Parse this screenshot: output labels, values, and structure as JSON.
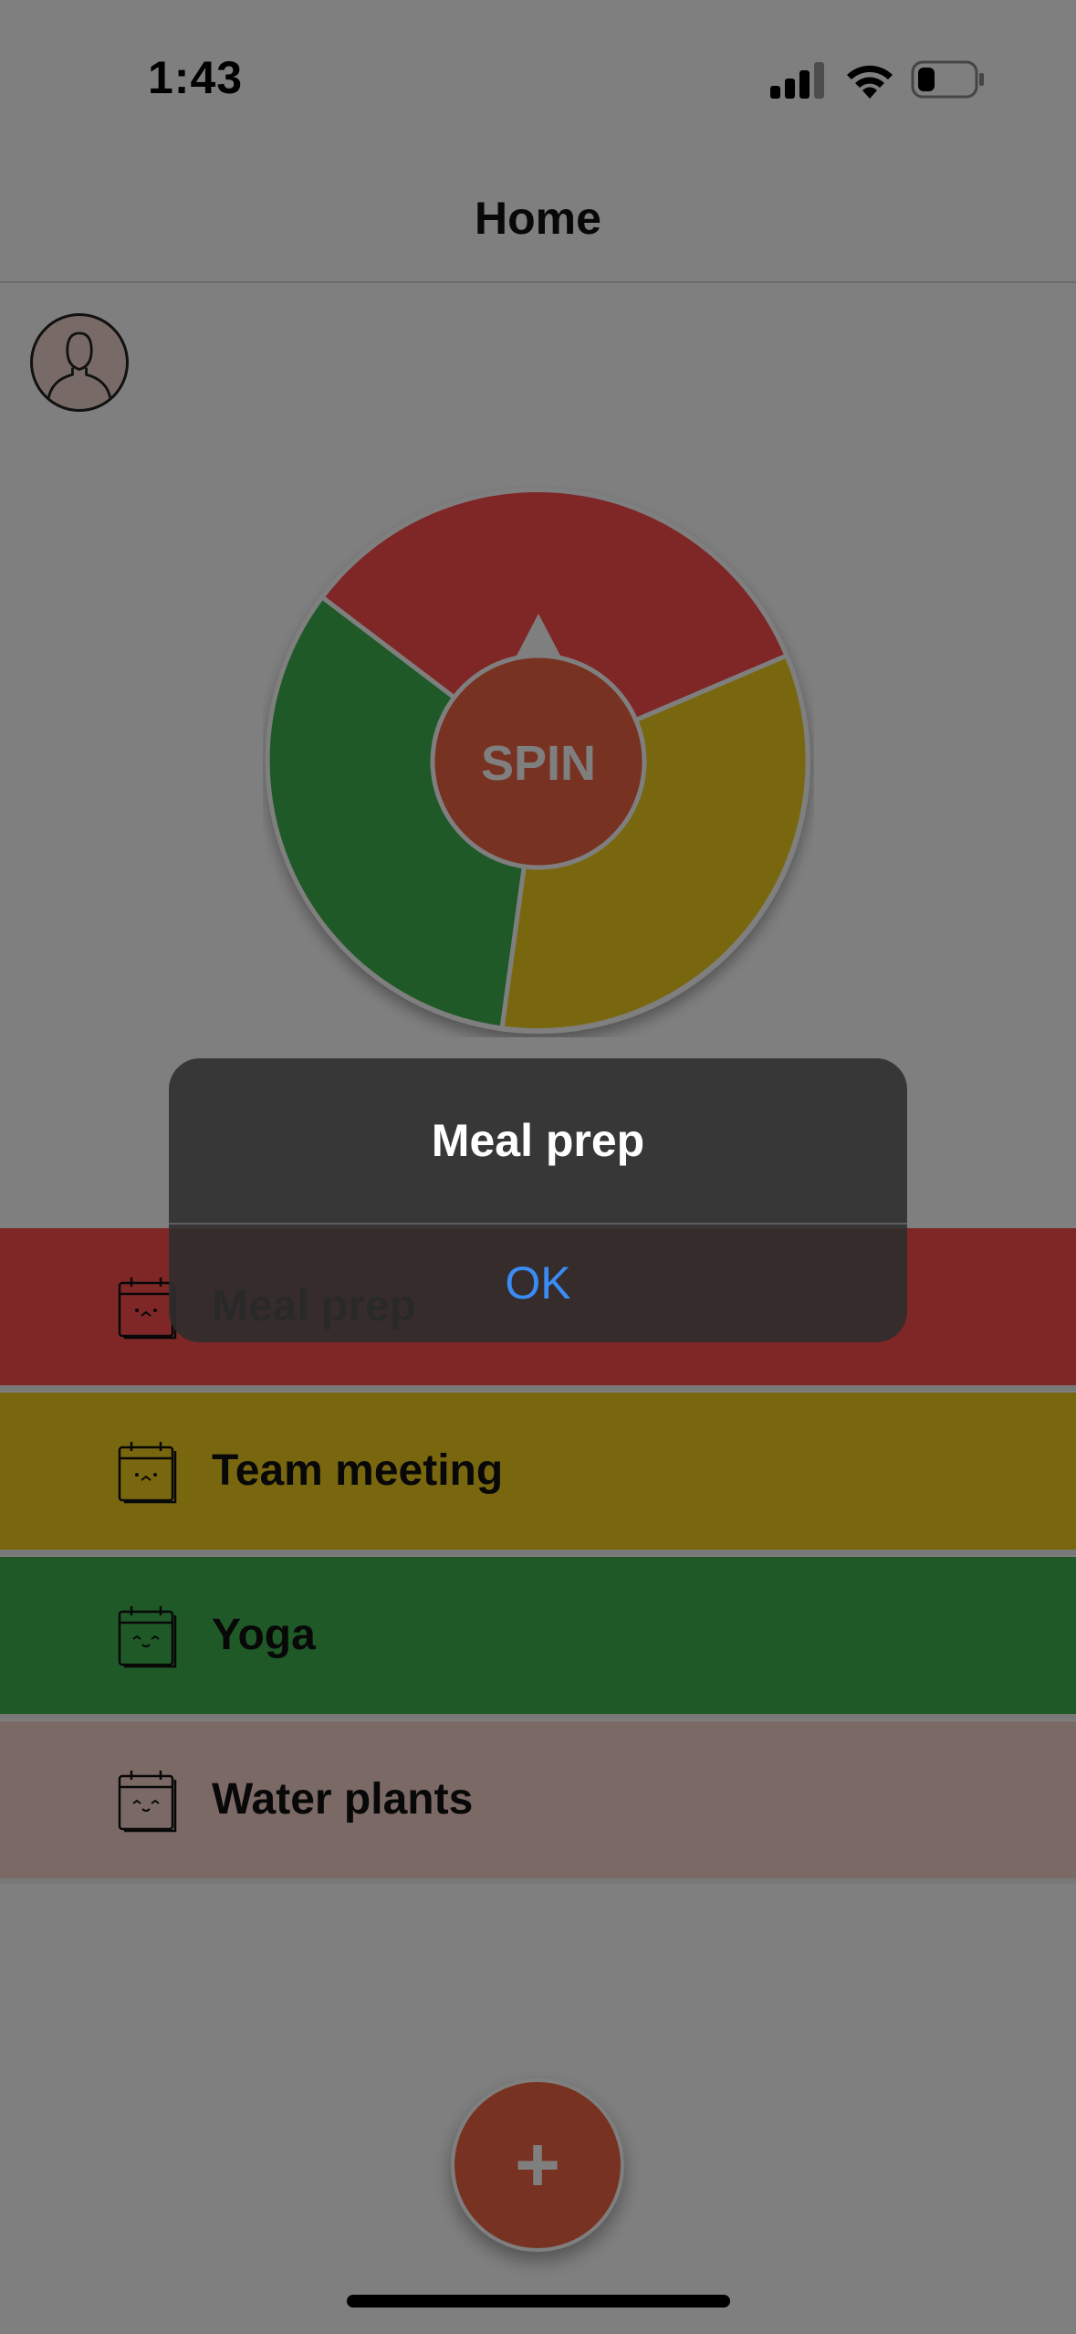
{
  "status_bar": {
    "time": "1:43",
    "icons": [
      "signal-icon",
      "wifi-icon",
      "battery-icon"
    ]
  },
  "nav": {
    "title": "Home"
  },
  "profile": {
    "icon": "person-icon"
  },
  "wheel": {
    "center_label": "SPIN",
    "segment_colors": [
      "#ff4e4e",
      "#3fb34f",
      "#f2ce21"
    ],
    "center_color": "#f06543"
  },
  "tasks": [
    {
      "label": "Meal prep",
      "color": "#ff4e4e",
      "icon": "calendar-icon"
    },
    {
      "label": "Team meeting",
      "color": "#f2ce21",
      "icon": "calendar-icon"
    },
    {
      "label": "Yoga",
      "color": "#3fb34f",
      "icon": "calendar-icon"
    },
    {
      "label": "Water plants",
      "color": "#f6d3cb",
      "icon": "calendar-icon"
    }
  ],
  "fab": {
    "label": "+"
  },
  "alert": {
    "title": "Meal prep",
    "button": "OK"
  }
}
